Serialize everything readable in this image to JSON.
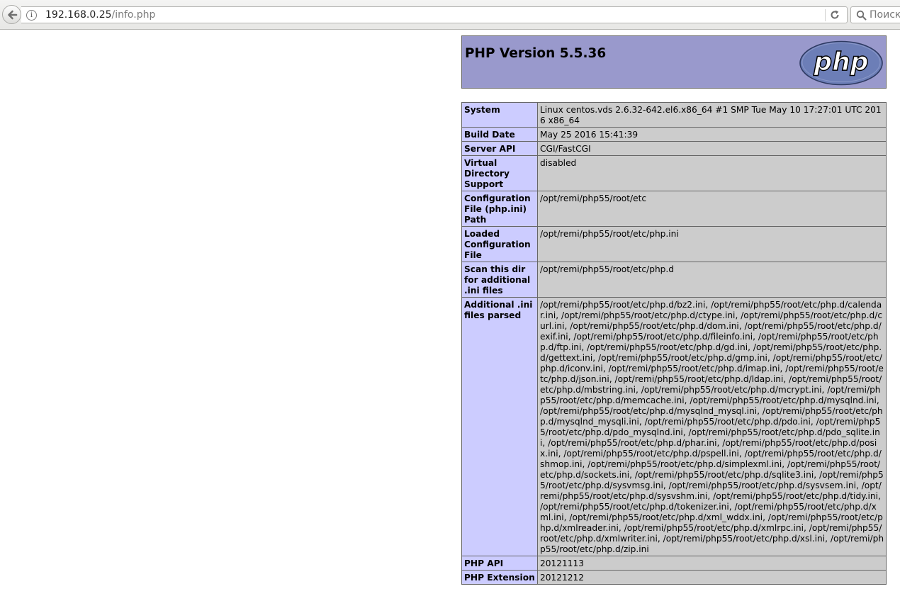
{
  "browser": {
    "url_host": "192.168.0.25",
    "url_path": "/info.php",
    "search_placeholder": "Поиск"
  },
  "php_header": {
    "title": "PHP Version 5.5.36",
    "logo_text": "php"
  },
  "info_rows": [
    {
      "key": "System",
      "value": "Linux centos.vds 2.6.32-642.el6.x86_64 #1 SMP Tue May 10 17:27:01 UTC 2016 x86_64"
    },
    {
      "key": "Build Date",
      "value": "May 25 2016 15:41:39"
    },
    {
      "key": "Server API",
      "value": "CGI/FastCGI"
    },
    {
      "key": "Virtual Directory Support",
      "value": "disabled"
    },
    {
      "key": "Configuration File (php.ini) Path",
      "value": "/opt/remi/php55/root/etc"
    },
    {
      "key": "Loaded Configuration File",
      "value": "/opt/remi/php55/root/etc/php.ini"
    },
    {
      "key": "Scan this dir for additional .ini files",
      "value": "/opt/remi/php55/root/etc/php.d"
    },
    {
      "key": "Additional .ini files parsed",
      "value": "/opt/remi/php55/root/etc/php.d/bz2.ini, /opt/remi/php55/root/etc/php.d/calendar.ini, /opt/remi/php55/root/etc/php.d/ctype.ini, /opt/remi/php55/root/etc/php.d/curl.ini, /opt/remi/php55/root/etc/php.d/dom.ini, /opt/remi/php55/root/etc/php.d/exif.ini, /opt/remi/php55/root/etc/php.d/fileinfo.ini, /opt/remi/php55/root/etc/php.d/ftp.ini, /opt/remi/php55/root/etc/php.d/gd.ini, /opt/remi/php55/root/etc/php.d/gettext.ini, /opt/remi/php55/root/etc/php.d/gmp.ini, /opt/remi/php55/root/etc/php.d/iconv.ini, /opt/remi/php55/root/etc/php.d/imap.ini, /opt/remi/php55/root/etc/php.d/json.ini, /opt/remi/php55/root/etc/php.d/ldap.ini, /opt/remi/php55/root/etc/php.d/mbstring.ini, /opt/remi/php55/root/etc/php.d/mcrypt.ini, /opt/remi/php55/root/etc/php.d/memcache.ini, /opt/remi/php55/root/etc/php.d/mysqlnd.ini, /opt/remi/php55/root/etc/php.d/mysqlnd_mysql.ini, /opt/remi/php55/root/etc/php.d/mysqlnd_mysqli.ini, /opt/remi/php55/root/etc/php.d/pdo.ini, /opt/remi/php55/root/etc/php.d/pdo_mysqlnd.ini, /opt/remi/php55/root/etc/php.d/pdo_sqlite.ini, /opt/remi/php55/root/etc/php.d/phar.ini, /opt/remi/php55/root/etc/php.d/posix.ini, /opt/remi/php55/root/etc/php.d/pspell.ini, /opt/remi/php55/root/etc/php.d/shmop.ini, /opt/remi/php55/root/etc/php.d/simplexml.ini, /opt/remi/php55/root/etc/php.d/sockets.ini, /opt/remi/php55/root/etc/php.d/sqlite3.ini, /opt/remi/php55/root/etc/php.d/sysvmsg.ini, /opt/remi/php55/root/etc/php.d/sysvsem.ini, /opt/remi/php55/root/etc/php.d/sysvshm.ini, /opt/remi/php55/root/etc/php.d/tidy.ini, /opt/remi/php55/root/etc/php.d/tokenizer.ini, /opt/remi/php55/root/etc/php.d/xml.ini, /opt/remi/php55/root/etc/php.d/xml_wddx.ini, /opt/remi/php55/root/etc/php.d/xmlreader.ini, /opt/remi/php55/root/etc/php.d/xmlrpc.ini, /opt/remi/php55/root/etc/php.d/xmlwriter.ini, /opt/remi/php55/root/etc/php.d/xsl.ini, /opt/remi/php55/root/etc/php.d/zip.ini"
    },
    {
      "key": "PHP API",
      "value": "20121113"
    },
    {
      "key": "PHP Extension",
      "value": "20121212"
    }
  ],
  "colors": {
    "header_bg": "#9999cc",
    "key_cell_bg": "#ccccff",
    "value_cell_bg": "#cccccc",
    "logo_fill": "#6c7eb7"
  }
}
